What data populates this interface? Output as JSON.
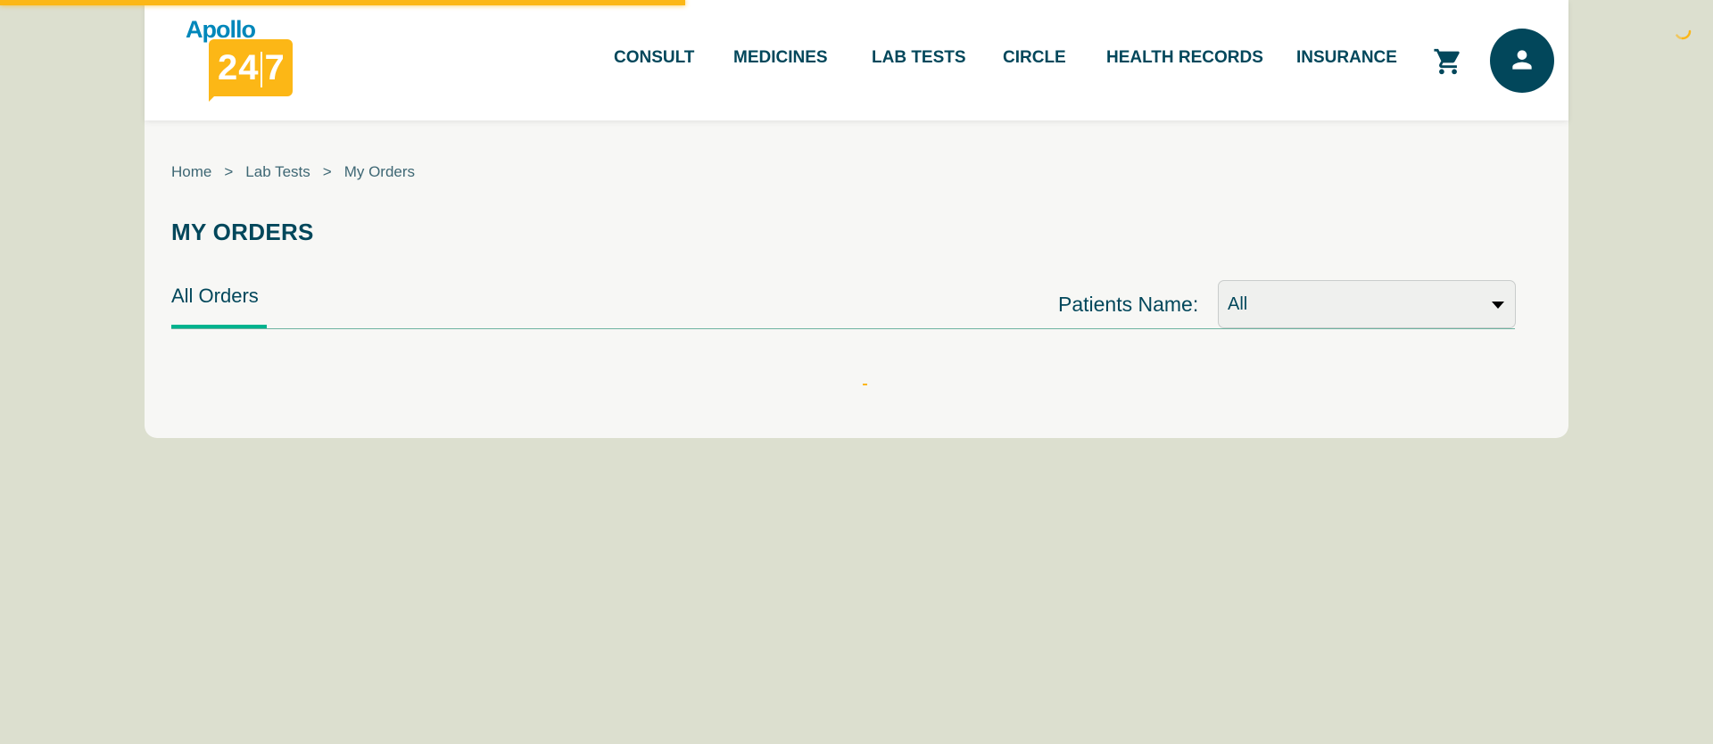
{
  "brand": {
    "logo_top": "Apollo",
    "logo_left": "24",
    "logo_right": "7",
    "accent_color": "#fcb716",
    "primary_color": "#02475b",
    "tab_active_color": "#00b38e"
  },
  "nav": {
    "items": [
      {
        "label": "CONSULT"
      },
      {
        "label": "MEDICINES"
      },
      {
        "label": "LAB TESTS"
      },
      {
        "label": "CIRCLE"
      },
      {
        "label": "HEALTH RECORDS"
      },
      {
        "label": "INSURANCE"
      }
    ],
    "cart_icon": "cart-icon",
    "profile_icon": "user-icon"
  },
  "breadcrumb": {
    "items": [
      {
        "label": "Home"
      },
      {
        "label": "Lab Tests"
      },
      {
        "label": "My Orders"
      }
    ],
    "separator": ">"
  },
  "page": {
    "title": "MY ORDERS"
  },
  "tabs": {
    "active_label": "All Orders"
  },
  "filter": {
    "label": "Patients Name:",
    "selected": "All"
  }
}
